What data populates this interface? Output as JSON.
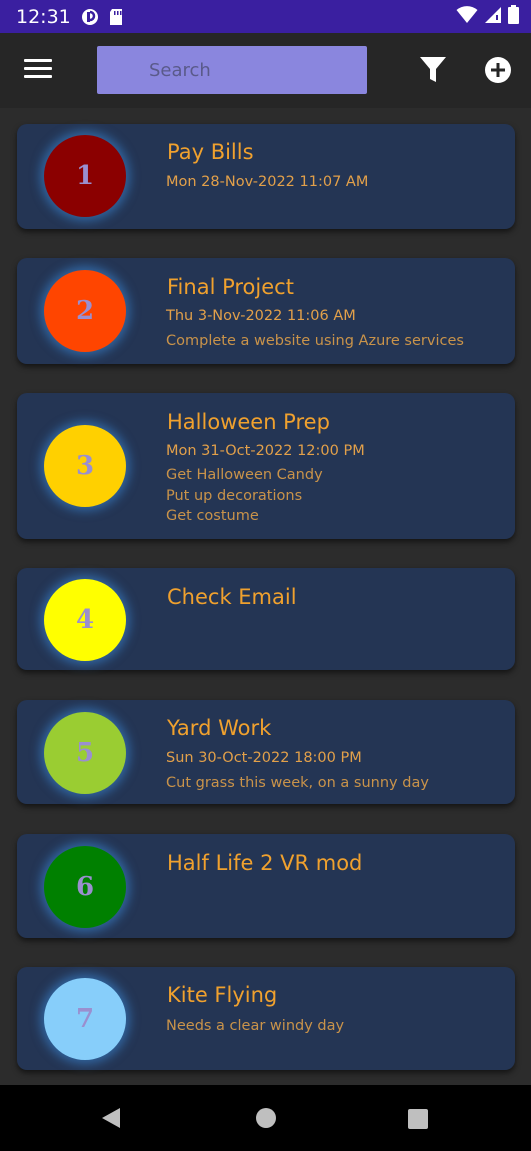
{
  "status_bar": {
    "time": "12:31"
  },
  "app_bar": {
    "search_placeholder": "Search",
    "menu_icon": "hamburger-menu-icon",
    "filter_icon": "filter-icon",
    "add_icon": "add-circle-icon"
  },
  "tasks": [
    {
      "number": "1",
      "title": "Pay Bills",
      "date": "Mon  28-Nov-2022  11:07 AM",
      "notes": "",
      "color": "#8b0000"
    },
    {
      "number": "2",
      "title": "Final Project",
      "date": "Thu  3-Nov-2022  11:06 AM",
      "notes": "Complete a website using Azure services",
      "color": "#ff4500"
    },
    {
      "number": "3",
      "title": "Halloween Prep",
      "date": "Mon  31-Oct-2022  12:00 PM",
      "notes": "Get Halloween Candy\nPut up decorations\nGet costume",
      "color": "#ffd000"
    },
    {
      "number": "4",
      "title": "Check Email",
      "date": "",
      "notes": "",
      "color": "#ffff00"
    },
    {
      "number": "5",
      "title": "Yard Work",
      "date": "Sun  30-Oct-2022  18:00 PM",
      "notes": "Cut grass this week, on a sunny day",
      "color": "#9acd32"
    },
    {
      "number": "6",
      "title": "Half Life 2 VR mod",
      "date": "",
      "notes": "",
      "color": "#008000"
    },
    {
      "number": "7",
      "title": "Kite Flying",
      "date": "",
      "notes": "Needs a clear windy day",
      "color": "#87cefa"
    }
  ],
  "nav_bar": {
    "back_icon": "back-triangle-icon",
    "home_icon": "home-circle-icon",
    "recents_icon": "recents-square-icon"
  }
}
